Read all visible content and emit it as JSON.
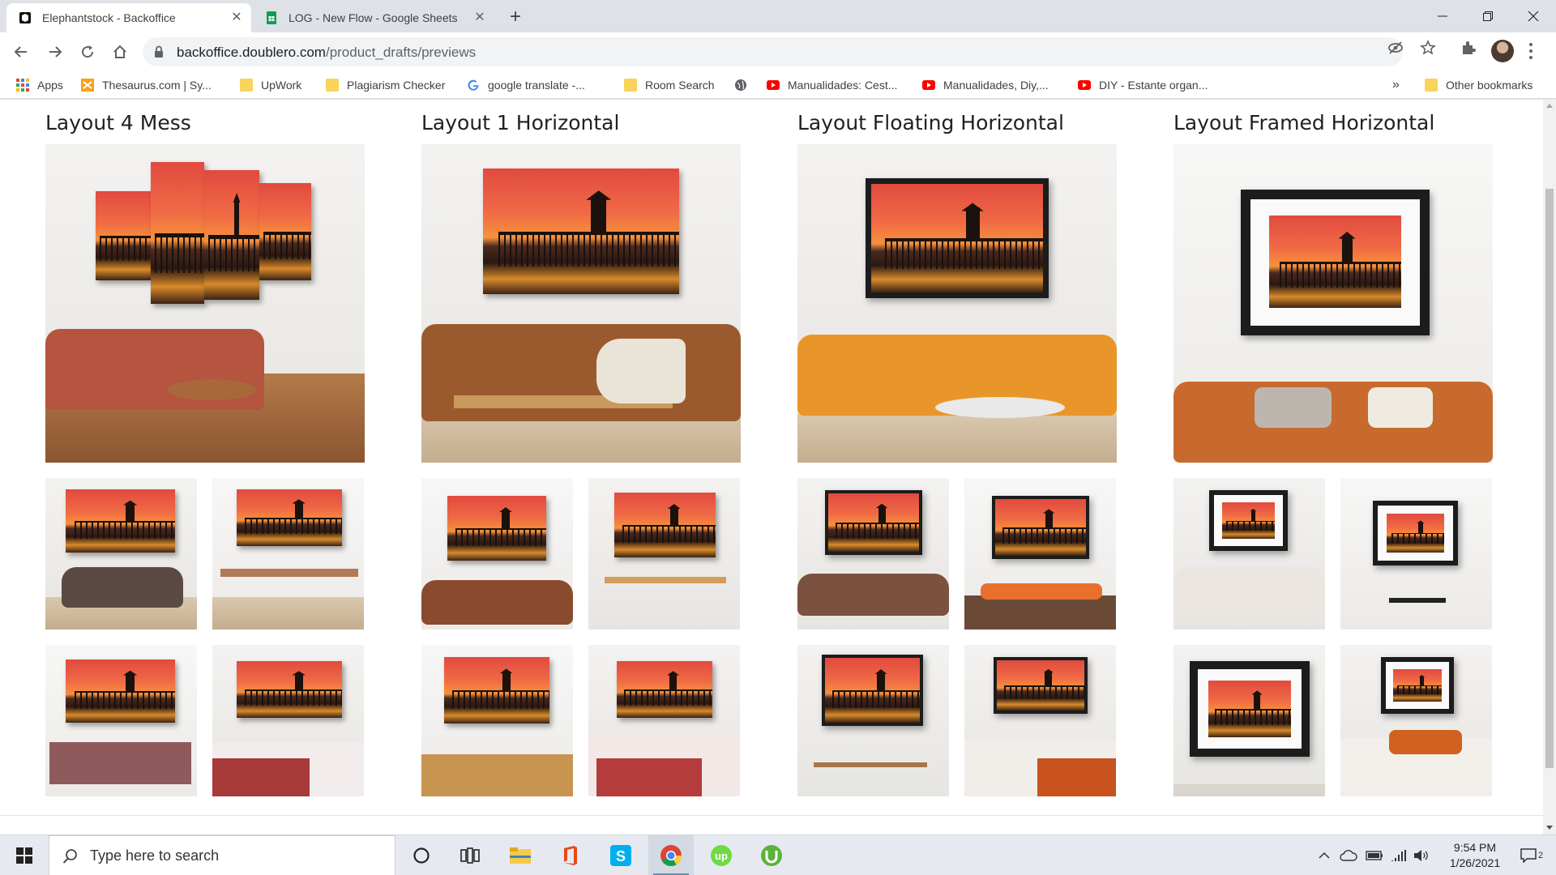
{
  "tabs": [
    {
      "title": "Elephantstock - Backoffice",
      "active": true
    },
    {
      "title": "LOG - New Flow - Google Sheets",
      "active": false
    }
  ],
  "address": {
    "domain": "backoffice.doublero.com",
    "path": "/product_drafts/previews"
  },
  "bookmarks": [
    {
      "label": "Apps",
      "icon": "apps-grid-icon"
    },
    {
      "label": "Thesaurus.com | Sy...",
      "icon": "thesaurus-icon"
    },
    {
      "label": "UpWork",
      "icon": "folder-icon"
    },
    {
      "label": "Plagiarism Checker",
      "icon": "folder-icon"
    },
    {
      "label": "google translate -...",
      "icon": "google-icon"
    },
    {
      "label": "Room Search",
      "icon": "folder-icon"
    },
    {
      "label": "",
      "icon": "globe-icon"
    },
    {
      "label": "Manualidades: Cest...",
      "icon": "youtube-icon"
    },
    {
      "label": "Manualidades, Diy,...",
      "icon": "youtube-icon"
    },
    {
      "label": "DIY - Estante organ...",
      "icon": "youtube-icon"
    }
  ],
  "bookmarks_overflow": "»",
  "other_bookmarks": "Other bookmarks",
  "layouts": [
    {
      "title": "Layout 4 Mess",
      "style": "split"
    },
    {
      "title": "Layout 1 Horizontal",
      "style": "canvas"
    },
    {
      "title": "Layout Floating Horizontal",
      "style": "floating"
    },
    {
      "title": "Layout Framed Horizontal",
      "style": "framed"
    }
  ],
  "taskbar": {
    "search_placeholder": "Type here to search",
    "apps": [
      "cortana-icon",
      "task-view-icon",
      "file-explorer-icon",
      "office-icon",
      "skype-icon",
      "chrome-icon",
      "upwork-icon",
      "utorrent-icon"
    ],
    "time": "9:54 PM",
    "date": "1/26/2021",
    "notification_count": "2"
  },
  "colors": {
    "accent_blue": "#1a73e8",
    "sunset_red": "#e14a3f",
    "sunset_orange": "#f7913b"
  }
}
